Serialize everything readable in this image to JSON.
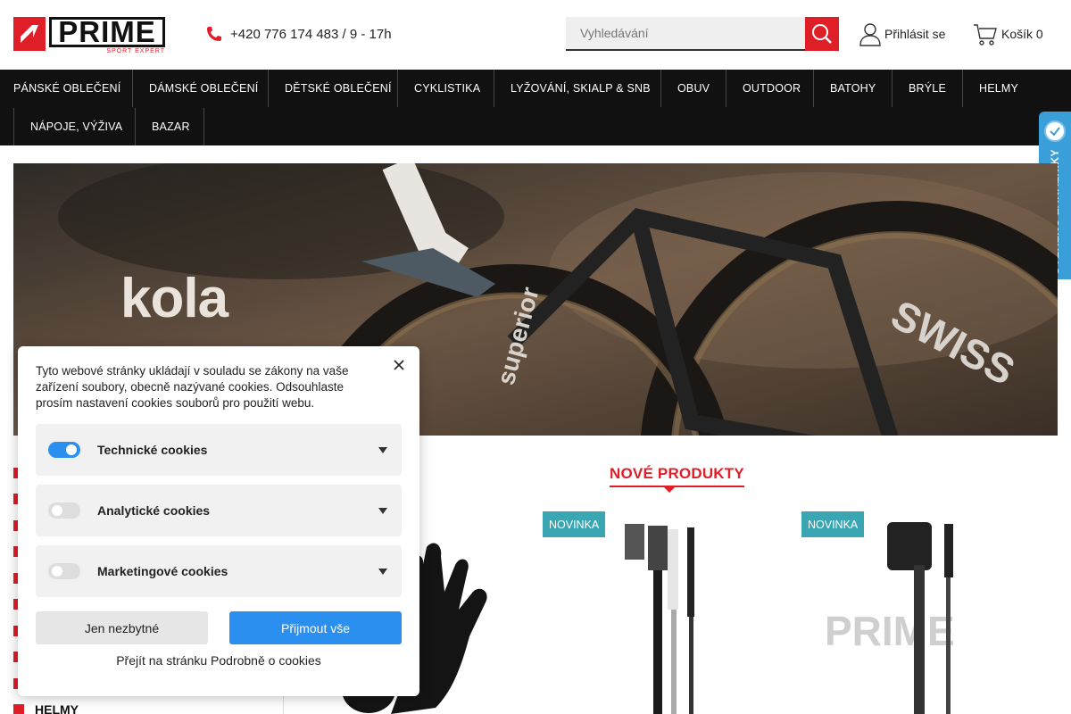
{
  "header": {
    "logo_word": "PRIME",
    "logo_sub": "SPORT EXPERT",
    "phone": "+420 776 174 483 / 9 - 17h",
    "search_placeholder": "Vyhledávání",
    "login_label": "Přihlásit se",
    "cart_label": "Košík 0"
  },
  "nav": {
    "row1": [
      "PÁNSKÉ OBLEČENÍ",
      "DÁMSKÉ OBLEČENÍ",
      "DĚTSKÉ OBLEČENÍ",
      "CYKLISTIKA",
      "LYŽOVÁNÍ, SKIALP & SNB",
      "OBUV",
      "OUTDOOR",
      "BATOHY",
      "BRÝLE",
      "HELMY"
    ],
    "row2": [
      "NÁPOJE, VÝŽIVA",
      "BAZAR"
    ]
  },
  "verified_badge": {
    "label": "OVĚŘENO ZÁKAZNÍKY"
  },
  "hero": {
    "text": "kola"
  },
  "categories": {
    "visible_label": "HELMY"
  },
  "new_products": {
    "title": "NOVÉ PRODUKTY",
    "badge": "NOVINKA"
  },
  "cookie": {
    "text": "Tyto webové stránky ukládají v souladu se zákony na vaše zařízení soubory, obecně nazývané cookies. Odsouhlaste prosím nastavení cookies souborů pro použití webu.",
    "categories": [
      {
        "label": "Technické cookies",
        "enabled": true
      },
      {
        "label": "Analytické cookies",
        "enabled": false
      },
      {
        "label": "Marketingové cookies",
        "enabled": false
      }
    ],
    "btn_necessary": "Jen nezbytné",
    "btn_accept": "Přijmout vše",
    "link": "Přejít na stránku Podrobně o cookies"
  },
  "colors": {
    "brand_red": "#e01e28",
    "nav_bg": "#111111",
    "accept_blue": "#2b8ff0",
    "badge_teal": "#3aa5b3",
    "verified_blue": "#3a9fd8"
  }
}
